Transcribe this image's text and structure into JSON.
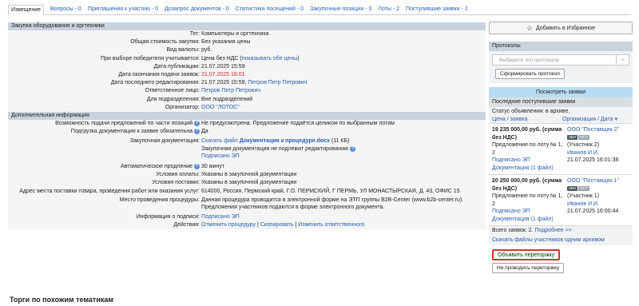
{
  "tabs": [
    {
      "label": "Извещение",
      "active": true
    },
    {
      "label": "Вопросы - 0"
    },
    {
      "label": "Приглашения к участию - 0"
    },
    {
      "label": "Дозапрос документов - 0"
    },
    {
      "label": "Статистика посещений - 0"
    },
    {
      "label": "Закупочные позиции - 3"
    },
    {
      "label": "Лоты - 2"
    },
    {
      "label": "Поступившие заявки - 2"
    }
  ],
  "section1": {
    "title": "Закупка оборудования и оргтехники",
    "rows": [
      {
        "label": "Тег:",
        "value": "Компьютеры и оргтехника"
      },
      {
        "label": "Общая стоимость закупки:",
        "value": "Без указания цены"
      },
      {
        "label": "Вид валюты:",
        "value": "руб."
      },
      {
        "label": "При выборе победителя учитывается:",
        "value": "Цена без НДС (",
        "link": "показывать обе цены",
        "suffix": ")"
      },
      {
        "label": "Дата публикации:",
        "value": "21.07.2025 15:59"
      },
      {
        "label": "Дата окончания подачи заявок:",
        "value": "21.07.2025 16:01",
        "red": true
      },
      {
        "label": "Дата последнего редактирования:",
        "value": "21.07.2025 15:59, ",
        "link": "Петров Петр Петрович"
      },
      {
        "label": "Ответственное лицо:",
        "link": "Петров Петр Петрович"
      },
      {
        "label": "Для подразделения:",
        "value": "Вне подразделений"
      },
      {
        "label": "Организатор:",
        "link": "ООО \"ЛОТОС\""
      }
    ]
  },
  "section2": {
    "title": "Дополнительная информация",
    "partial_label": "Возможность подачи предложений по части позиций",
    "partial_value": "Не предусмотрена. Предложение подаётся целиком по выбранным лотам",
    "upload_label": "Подгрузка документации к заявке обязательна",
    "upload_value": "Да",
    "docs_label": "Закупочная документация:",
    "docs_download": "Скачать файл",
    "docs_file": "Документация к процедуре.docx",
    "docs_size": "(11 КБ)",
    "docs_note": "Закупочная документация не подлежит редактированию",
    "docs_signed": "Подписано ЭП",
    "autoext_label": "Автоматическое продление",
    "autoext_value": "30 минут",
    "pay_label": "Условия оплаты:",
    "pay_value": "Указаны в закупочной документации",
    "supply_label": "Условия поставки:",
    "supply_value": "Указаны в закупочной документации",
    "address_label": "Адрес места поставки товара, проведения работ или оказания услуг:",
    "address_value": "614000, Россия, Пермский край, Г.О. ПЕРМСКИЙ, Г ПЕРМЬ, УЛ МОНАСТЫРСКАЯ, Д. 43, ОФИС 15",
    "place_label": "Место проведения процедуры:",
    "place_value1": "Данная процедура проводится в электронной форме на ЭТП группы B2B-Center (www.b2b-center.ru).",
    "place_value2": "Предложения участников подаются в форме электронного документа.",
    "sign_label": "Информация о подписи:",
    "sign_value": "Подписано ЭП",
    "actions_label": "Действия:",
    "action_cancel": "Отменить процедуру",
    "action_copy": "Скопировать",
    "action_change": "Изменить ответственного",
    "sep": " | "
  },
  "side": {
    "favorite_label": "Добавить в Избранное",
    "favorite_icon": "star-outline-icon",
    "protocols_title": "Протоколы",
    "protocol_placeholder": "Выберите тип протокола",
    "form_protocol": "Сформировать протокол",
    "view_bids": "Посмотреть заявки",
    "recent_bids": "Последние поступившие заявки",
    "status": "Статус объявления: в архиве.",
    "col_price": "Цена / заявка",
    "col_org": "Организация / Дата ▾",
    "bids": [
      {
        "price": "19 235 000,00 руб. (сумма без НДС)",
        "offer": "Предложение по лоту № 1, 2",
        "signed": "Подписано ЭП",
        "docs": "Документация (1 файл)",
        "org": "ООО \"Поставщик 2\"",
        "badge1": "ЗВН",
        "badge2": "МСП",
        "part": "(Участник 2)",
        "person": "Иванов И.И.",
        "date": "21.07.2025 16:01:38"
      },
      {
        "price": "20 250 000,00 руб. (сумма без НДС)",
        "offer": "Предложение по лоту № 1, 2",
        "signed": "Подписано ЭП",
        "docs": "Документация (1 файл)",
        "org": "ООО \"Поставщик 1\"",
        "badge1": "ЗВН",
        "badge2": "МСП",
        "part": "(Участник 1)",
        "person": "Иванов И.И.",
        "date": "21.07.2025 16:00:44"
      }
    ],
    "total": "Всего заявок: 2.",
    "more": "Подробнее >>",
    "download_all": "Скачать файлы участников одним архивом",
    "announce_rebid": "Объявить переторжку",
    "no_rebid": "Не проводить переторжку"
  },
  "similar_title": "Торги по похожим тематикам"
}
